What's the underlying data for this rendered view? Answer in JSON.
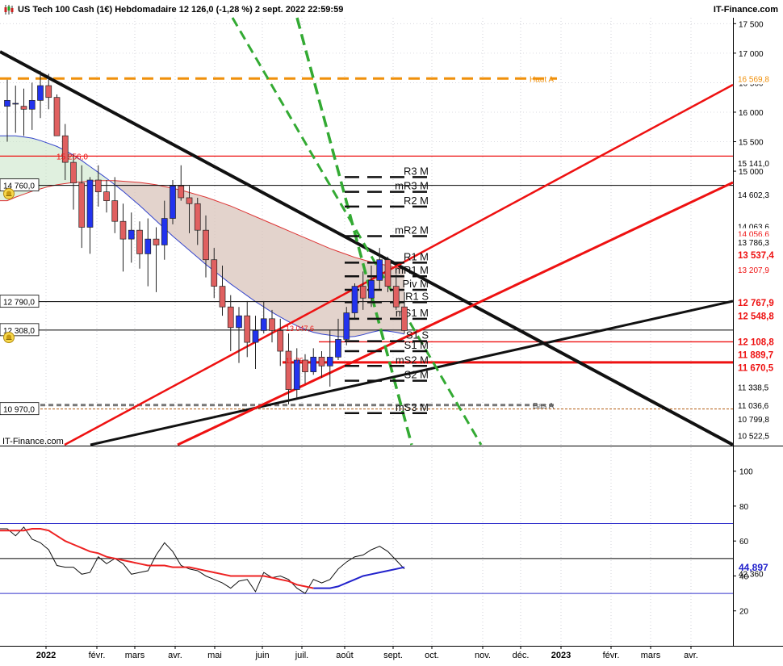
{
  "header": {
    "title": "US Tech 100 Cash (1€) Hebdomadaire 12 126,0 (-1,28 %) 2 sept. 2022 22:59:59",
    "brand": "IT-Finance.com"
  },
  "watermark": "IT-Finance.com",
  "colors": {
    "bull": "#2233ee",
    "bear": "#e06060",
    "trend_black": "#111111",
    "trend_red": "#ee1111",
    "trend_green": "#33aa33",
    "haut_orange": "#f0900a",
    "ma_blue": "#3344cc",
    "ma_red": "#dd3333"
  },
  "chart_data": [
    {
      "type": "candlestick",
      "ylim": [
        10350,
        17600
      ],
      "y_ticks": [
        "17 500",
        "17 000",
        "16 500",
        "16 000",
        "15 500",
        "15 000",
        "10 522,5"
      ],
      "x_labels": [
        "2022",
        "févr.",
        "mars",
        "avr.",
        "mai",
        "juin",
        "juil.",
        "août",
        "sept.",
        "oct.",
        "nov.",
        "déc.",
        "2023",
        "févr.",
        "mars",
        "avr."
      ],
      "candles": [
        {
          "o": 16100,
          "h": 16550,
          "l": 15500,
          "c": 16200
        },
        {
          "o": 16150,
          "h": 16450,
          "l": 15650,
          "c": 16150
        },
        {
          "o": 16100,
          "h": 16400,
          "l": 15600,
          "c": 16050
        },
        {
          "o": 16050,
          "h": 16500,
          "l": 15700,
          "c": 16200
        },
        {
          "o": 16200,
          "h": 16700,
          "l": 15900,
          "c": 16450
        },
        {
          "o": 16450,
          "h": 16650,
          "l": 16050,
          "c": 16250
        },
        {
          "o": 16250,
          "h": 16300,
          "l": 15700,
          "c": 15600
        },
        {
          "o": 15600,
          "h": 15800,
          "l": 14850,
          "c": 15150
        },
        {
          "o": 15150,
          "h": 15300,
          "l": 14350,
          "c": 14800
        },
        {
          "o": 14800,
          "h": 15100,
          "l": 13700,
          "c": 14050
        },
        {
          "o": 14050,
          "h": 14900,
          "l": 13600,
          "c": 14850
        },
        {
          "o": 14850,
          "h": 15100,
          "l": 14400,
          "c": 14650
        },
        {
          "o": 14650,
          "h": 14850,
          "l": 14300,
          "c": 14500
        },
        {
          "o": 14500,
          "h": 14900,
          "l": 13950,
          "c": 14150
        },
        {
          "o": 14150,
          "h": 14450,
          "l": 13300,
          "c": 13850
        },
        {
          "o": 13850,
          "h": 14300,
          "l": 13450,
          "c": 14000
        },
        {
          "o": 14000,
          "h": 14150,
          "l": 13350,
          "c": 13600
        },
        {
          "o": 13600,
          "h": 14200,
          "l": 13050,
          "c": 13850
        },
        {
          "o": 13850,
          "h": 14050,
          "l": 12950,
          "c": 13750
        },
        {
          "o": 13750,
          "h": 14500,
          "l": 13500,
          "c": 14200
        },
        {
          "o": 14200,
          "h": 14850,
          "l": 14100,
          "c": 14750
        },
        {
          "o": 14750,
          "h": 15100,
          "l": 14500,
          "c": 14550
        },
        {
          "o": 14550,
          "h": 14750,
          "l": 13950,
          "c": 14450
        },
        {
          "o": 14450,
          "h": 14550,
          "l": 13750,
          "c": 14000
        },
        {
          "o": 14000,
          "h": 14250,
          "l": 13200,
          "c": 13500
        },
        {
          "o": 13500,
          "h": 13700,
          "l": 12850,
          "c": 13050
        },
        {
          "o": 13050,
          "h": 13400,
          "l": 12550,
          "c": 12700
        },
        {
          "o": 12700,
          "h": 12900,
          "l": 11950,
          "c": 12350
        },
        {
          "o": 12350,
          "h": 12700,
          "l": 11750,
          "c": 12550
        },
        {
          "o": 12550,
          "h": 12800,
          "l": 11850,
          "c": 12100
        },
        {
          "o": 12100,
          "h": 12550,
          "l": 11650,
          "c": 12300
        },
        {
          "o": 12300,
          "h": 12800,
          "l": 12250,
          "c": 12500
        },
        {
          "o": 12500,
          "h": 12650,
          "l": 12100,
          "c": 12300
        },
        {
          "o": 12300,
          "h": 12500,
          "l": 11700,
          "c": 11950
        },
        {
          "o": 11950,
          "h": 12250,
          "l": 11050,
          "c": 11300
        },
        {
          "o": 11300,
          "h": 12000,
          "l": 11150,
          "c": 11800
        },
        {
          "o": 11800,
          "h": 11900,
          "l": 11400,
          "c": 11600
        },
        {
          "o": 11600,
          "h": 12000,
          "l": 11550,
          "c": 11850
        },
        {
          "o": 11850,
          "h": 11950,
          "l": 11500,
          "c": 11700
        },
        {
          "o": 11700,
          "h": 12300,
          "l": 11350,
          "c": 11850
        },
        {
          "o": 11850,
          "h": 12500,
          "l": 11800,
          "c": 12150
        },
        {
          "o": 12150,
          "h": 12700,
          "l": 12050,
          "c": 12600
        },
        {
          "o": 12600,
          "h": 13100,
          "l": 12500,
          "c": 13050
        },
        {
          "o": 13050,
          "h": 13300,
          "l": 12650,
          "c": 12850
        },
        {
          "o": 12850,
          "h": 13400,
          "l": 12700,
          "c": 13150
        },
        {
          "o": 13150,
          "h": 13700,
          "l": 13000,
          "c": 13500
        },
        {
          "o": 13500,
          "h": 13550,
          "l": 12950,
          "c": 13050
        },
        {
          "o": 13050,
          "h": 13250,
          "l": 12650,
          "c": 12700
        },
        {
          "o": 12700,
          "h": 12950,
          "l": 12250,
          "c": 12300
        }
      ],
      "series": [
        {
          "values": [
            15600,
            15600,
            15580,
            15560,
            15520,
            15470,
            15420,
            15350,
            15270,
            15180,
            15080,
            14980,
            14880,
            14770,
            14660,
            14540,
            14420,
            14290,
            14160,
            14030,
            13900,
            13780,
            13660,
            13540,
            13420,
            13310,
            13200,
            13090,
            12990,
            12890,
            12790,
            12700,
            12610,
            12530,
            12450,
            12380,
            12320,
            12270,
            12240,
            12220,
            12200,
            12190,
            12200,
            12230,
            12270,
            12300,
            12290,
            12270,
            12240
          ]
        },
        {
          "values": [
            14500,
            14560,
            14610,
            14660,
            14700,
            14740,
            14770,
            14790,
            14810,
            14820,
            14830,
            14840,
            14840,
            14840,
            14830,
            14820,
            14810,
            14790,
            14770,
            14740,
            14710,
            14680,
            14640,
            14600,
            14560,
            14510,
            14460,
            14410,
            14350,
            14290,
            14230,
            14170,
            14110,
            14050,
            13990,
            13930,
            13870,
            13810,
            13750,
            13690,
            13640,
            13590,
            13540,
            13500,
            13460,
            13430,
            13400,
            13370,
            13340
          ]
        }
      ],
      "annotations": [
        {
          "text": "Haut A",
          "y": 16569.8
        },
        {
          "text": "Bas A",
          "y": 11036.6
        },
        {
          "text": "15 256,0",
          "y": 15256
        },
        {
          "text": "14 760,0",
          "y": 14760
        },
        {
          "text": "12 790,0",
          "y": 12790
        },
        {
          "text": "12 308,0",
          "y": 12308
        },
        {
          "text": "10 970,0",
          "y": 10970
        },
        {
          "text": "13 047,6",
          "y": 12350
        },
        {
          "text": "11 75",
          "y": 11800
        }
      ],
      "price_labels": [
        {
          "text": "16 569,8",
          "y": 16569.8,
          "color": "#f0900a"
        },
        {
          "text": "15 141,0",
          "y": 15141
        },
        {
          "text": "14 602,3",
          "y": 14602.3
        },
        {
          "text": "14 063,6",
          "y": 14063.6
        },
        {
          "text": "14 056,6",
          "y": 13940,
          "color": "#ee1111"
        },
        {
          "text": "13 786,3",
          "y": 13800
        },
        {
          "text": "13 537,4",
          "y": 13580,
          "color": "#ee1111",
          "bold": true
        },
        {
          "text": "13 207,9",
          "y": 13330,
          "color": "#ee1111"
        },
        {
          "text": "12 767,9",
          "y": 12767.9,
          "color": "#ee1111",
          "bold": true
        },
        {
          "text": "12 548,8",
          "y": 12548.8,
          "color": "#ee1111",
          "bold": true
        },
        {
          "text": "12 108,8",
          "y": 12108.8,
          "color": "#ee1111",
          "bold": true
        },
        {
          "text": "11 889,7",
          "y": 11889.7,
          "color": "#ee1111",
          "bold": true
        },
        {
          "text": "11 670,5",
          "y": 11670.5,
          "color": "#ee1111",
          "bold": true
        },
        {
          "text": "11 338,5",
          "y": 11338.5
        },
        {
          "text": "11 036,6",
          "y": 11036.6
        },
        {
          "text": "10 799,8",
          "y": 10799.8
        },
        {
          "text": "10 522,5",
          "y": 10522.5
        }
      ],
      "pivots": [
        {
          "text": "R3 M",
          "y": 14900
        },
        {
          "text": "mR3 M",
          "y": 14650
        },
        {
          "text": "R2 M",
          "y": 14400
        },
        {
          "text": "mR2 M",
          "y": 13900
        },
        {
          "text": "R1 M",
          "y": 13450
        },
        {
          "text": "mR1 M",
          "y": 13220
        },
        {
          "text": "Piv M",
          "y": 12990
        },
        {
          "text": "R1 S",
          "y": 12780
        },
        {
          "text": "mS1 M",
          "y": 12500
        },
        {
          "text": "S1 S",
          "y": 12120
        },
        {
          "text": "S1 M",
          "y": 11950
        },
        {
          "text": "mS2 M",
          "y": 11700
        },
        {
          "text": "S2 M",
          "y": 11450
        },
        {
          "text": "mS3 M",
          "y": 10900
        }
      ]
    },
    {
      "type": "line",
      "ylim": [
        0,
        110
      ],
      "y_ticks": [
        "100",
        "80",
        "60",
        "40",
        "20"
      ],
      "levels": [
        70,
        30
      ],
      "reference_line": 50,
      "value_labels": [
        {
          "text": "44,897",
          "y": 44.9,
          "color": "#2222cc",
          "bold": true
        },
        {
          "text": "42,360",
          "y": 42.4
        }
      ],
      "series": [
        {
          "values": [
            67,
            63,
            68,
            61,
            59,
            55,
            46,
            45,
            45,
            41,
            42,
            51,
            47,
            50,
            47,
            41,
            42,
            43,
            52,
            59,
            54,
            46,
            44,
            43,
            40,
            38,
            36,
            33,
            37,
            38,
            31,
            42,
            39,
            40,
            38,
            33,
            30,
            38,
            36,
            38,
            44,
            48,
            51,
            52,
            55,
            57,
            54,
            49,
            44
          ]
        },
        {
          "values": [
            66,
            66,
            66,
            67,
            67,
            66,
            63,
            60,
            58,
            56,
            54,
            53,
            51,
            50,
            49,
            48,
            47,
            46,
            46,
            46,
            45,
            45,
            45,
            44,
            43,
            42,
            41,
            40,
            40,
            40,
            40,
            40,
            39,
            38,
            37,
            35,
            34,
            33,
            33,
            33,
            34,
            36,
            38,
            40,
            41,
            42,
            43,
            44,
            45
          ]
        }
      ]
    }
  ]
}
